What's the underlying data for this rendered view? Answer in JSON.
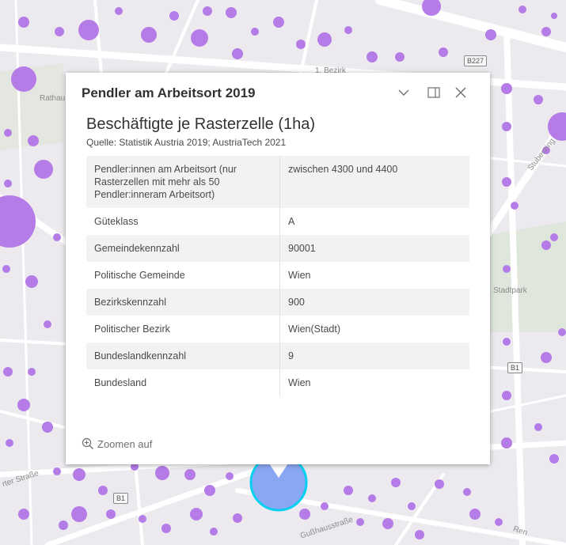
{
  "map": {
    "labels": {
      "district": "1. Bezirk",
      "rathaus": "Rathau",
      "stadtpark": "Stadtpark",
      "stubenring": "Stubenring",
      "street_left": "rter Straße",
      "gusshaus": "Gußhausstraße",
      "ren": "Ren"
    },
    "shields": [
      "B227",
      "B1",
      "B1"
    ],
    "colors": {
      "bubble": "#b57be6",
      "highlight_fill": "#8aa7f2",
      "highlight_stroke": "#00d0f0"
    }
  },
  "popup": {
    "title": "Pendler am Arbeitsort 2019",
    "buttons": {
      "collapse": "chevron-down",
      "dock": "dock",
      "close": "close"
    },
    "content_title": "Beschäftigte je Rasterzelle (1ha)",
    "source": "Quelle: Statistik Austria 2019; AustriaTech 2021",
    "rows": [
      {
        "key": "Pendler:innen am Arbeitsort (nur Rasterzellen mit mehr als 50 Pendler:inneram Arbeitsort)",
        "value": "zwischen 4300 und 4400"
      },
      {
        "key": "Güteklass",
        "value": "A"
      },
      {
        "key": "Gemeindekennzahl",
        "value": "90001"
      },
      {
        "key": "Politische Gemeinde",
        "value": "Wien"
      },
      {
        "key": "Bezirkskennzahl",
        "value": "900"
      },
      {
        "key": "Politischer Bezirk",
        "value": "Wien(Stadt)"
      },
      {
        "key": "Bundeslandkennzahl",
        "value": "9"
      },
      {
        "key": "Bundesland",
        "value": "Wien"
      }
    ],
    "zoom_label": "Zoomen auf"
  }
}
